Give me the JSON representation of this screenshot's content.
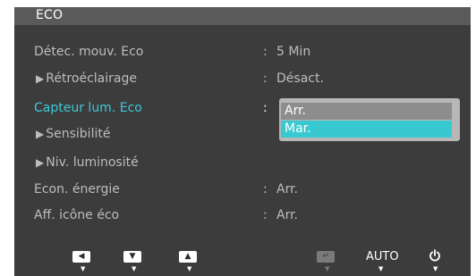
{
  "title": "ECO",
  "menu": {
    "rows": [
      {
        "label": "Détec. mouv. Eco",
        "colon": ":",
        "value": "5 Min"
      },
      {
        "label": "Rétroéclairage",
        "colon": ":",
        "value": "Désact."
      },
      {
        "label": "Capteur lum. Eco",
        "colon": ":",
        "value": ""
      },
      {
        "label": "Sensibilité",
        "colon": "",
        "value": ""
      },
      {
        "label": "Niv. luminosité",
        "colon": "",
        "value": ""
      },
      {
        "label": "Econ. énergie",
        "colon": ":",
        "value": "Arr."
      },
      {
        "label": "Aff. icône éco",
        "colon": ":",
        "value": "Arr."
      }
    ],
    "submenu_marker": "▶"
  },
  "dropdown": {
    "options": [
      "Arr.",
      "Mar."
    ],
    "selected": "Mar."
  },
  "bottom": {
    "left_label": "◀",
    "down_label": "▼",
    "up_label": "▲",
    "enter_label": "↵",
    "auto_label": "AUTO",
    "dot": "▼"
  },
  "colors": {
    "panel": "#3c3c3c",
    "title_bar": "#5a5a5a",
    "active_text": "#3ec8d8",
    "highlight": "#37c9cf"
  }
}
